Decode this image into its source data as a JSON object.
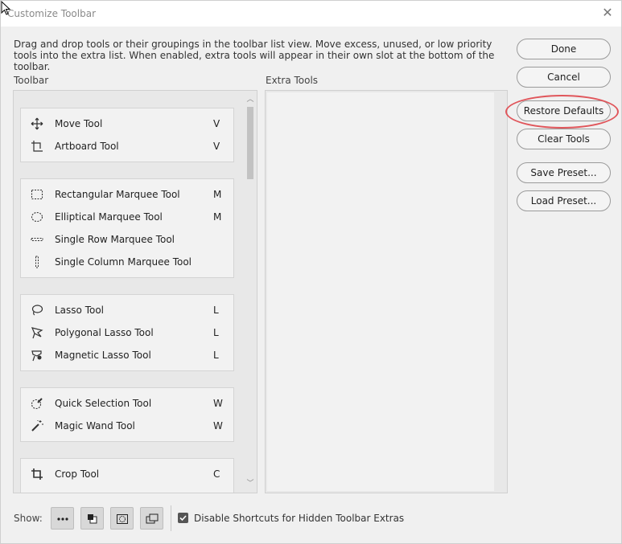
{
  "window": {
    "title": "Customize Toolbar",
    "close_icon": "close-icon"
  },
  "description": "Drag and drop tools or their groupings in the toolbar list view. Move excess, unused, or low priority tools into the extra list. When enabled, extra tools will appear in their own slot at the bottom of the toolbar.",
  "toolbar_label": "Toolbar",
  "extra_tools_label": "Extra Tools",
  "groups": [
    {
      "tools": [
        {
          "name": "Move Tool",
          "key": "V",
          "icon": "move-icon"
        },
        {
          "name": "Artboard Tool",
          "key": "V",
          "icon": "artboard-icon"
        }
      ]
    },
    {
      "tools": [
        {
          "name": "Rectangular Marquee Tool",
          "key": "M",
          "icon": "rect-marquee-icon"
        },
        {
          "name": "Elliptical Marquee Tool",
          "key": "M",
          "icon": "ellipse-marquee-icon"
        },
        {
          "name": "Single Row Marquee Tool",
          "key": "",
          "icon": "row-marquee-icon"
        },
        {
          "name": "Single Column Marquee Tool",
          "key": "",
          "icon": "column-marquee-icon"
        }
      ]
    },
    {
      "tools": [
        {
          "name": "Lasso Tool",
          "key": "L",
          "icon": "lasso-icon"
        },
        {
          "name": "Polygonal Lasso Tool",
          "key": "L",
          "icon": "polygonal-lasso-icon"
        },
        {
          "name": "Magnetic Lasso Tool",
          "key": "L",
          "icon": "magnetic-lasso-icon"
        }
      ]
    },
    {
      "tools": [
        {
          "name": "Quick Selection Tool",
          "key": "W",
          "icon": "quick-selection-icon"
        },
        {
          "name": "Magic Wand Tool",
          "key": "W",
          "icon": "magic-wand-icon"
        }
      ]
    },
    {
      "tools": [
        {
          "name": "Crop Tool",
          "key": "C",
          "icon": "crop-icon"
        }
      ]
    }
  ],
  "buttons": {
    "done": "Done",
    "cancel": "Cancel",
    "restore_defaults": "Restore Defaults",
    "clear_tools": "Clear Tools",
    "save_preset": "Save Preset...",
    "load_preset": "Load Preset..."
  },
  "bottom": {
    "show_label": "Show:",
    "view_buttons": [
      "more-icon",
      "foreground-background-icon",
      "quick-mask-icon",
      "screen-mode-icon"
    ],
    "checkbox_checked": true,
    "checkbox_label": "Disable Shortcuts for Hidden Toolbar Extras"
  },
  "colors": {
    "highlight": "#e0565b"
  }
}
